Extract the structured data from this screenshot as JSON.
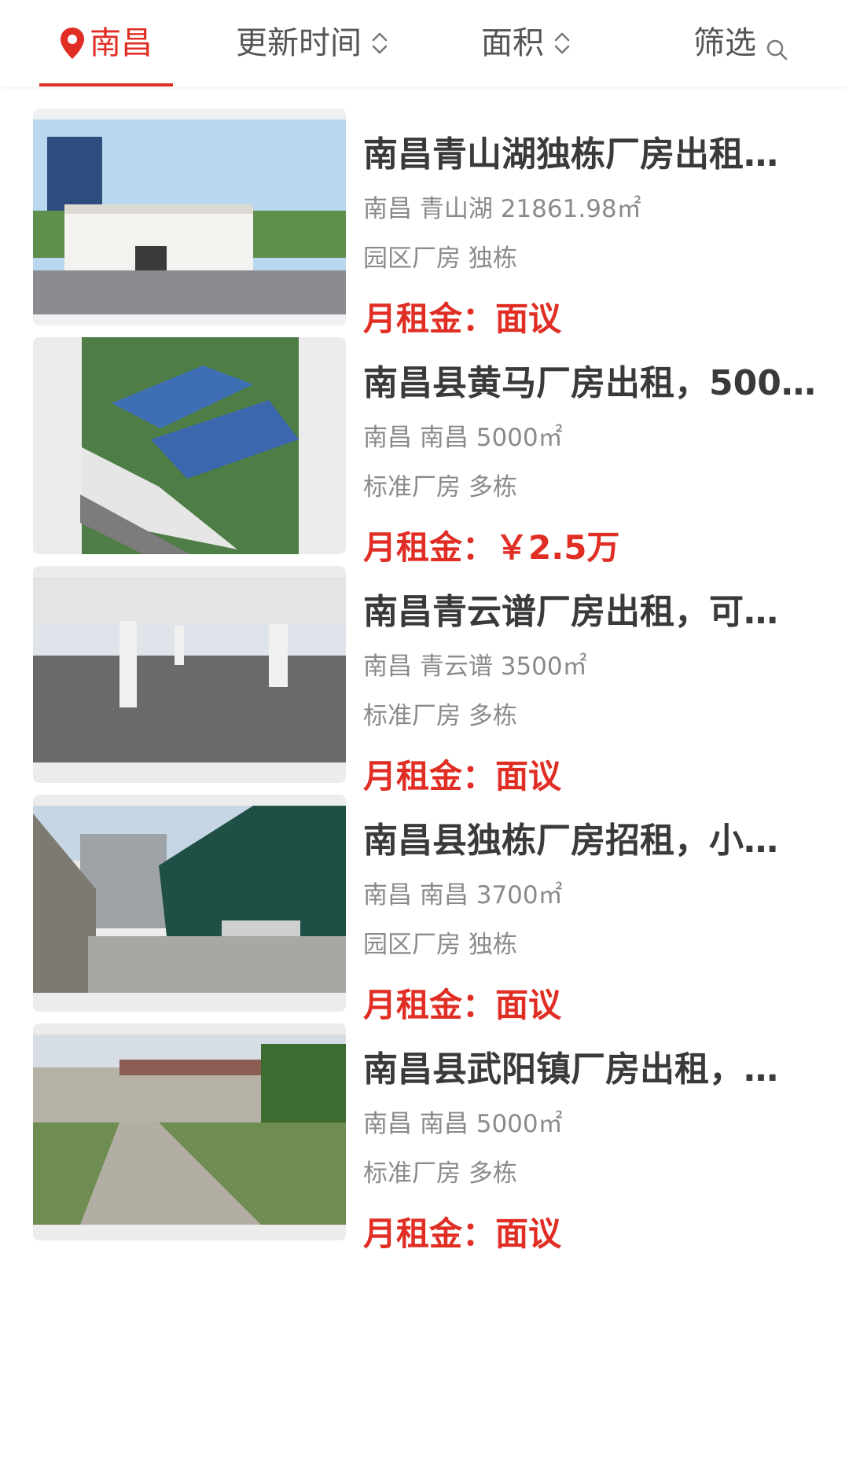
{
  "filter_bar": {
    "city": {
      "label": "南昌",
      "icon": "location-pin-icon"
    },
    "sort_time": {
      "label": "更新时间",
      "icon": "sort-updown-icon"
    },
    "sort_area": {
      "label": "面积",
      "icon": "sort-updown-icon"
    },
    "filter": {
      "label": "筛选",
      "icon": "search-icon"
    },
    "accent_color": "#e02e24"
  },
  "listings": [
    {
      "title": "南昌青山湖独栋厂房出租…",
      "city": "南昌",
      "district": "青山湖",
      "area": "21861.98㎡",
      "type": "园区厂房",
      "building": "独栋",
      "price_label": "月租金：",
      "price_value": "面议"
    },
    {
      "title": "南昌县黄马厂房出租，500…",
      "city": "南昌",
      "district": "南昌",
      "area": "5000㎡",
      "type": "标准厂房",
      "building": "多栋",
      "price_label": "月租金：",
      "price_value": "￥2.5万"
    },
    {
      "title": "南昌青云谱厂房出租，可…",
      "city": "南昌",
      "district": "青云谱",
      "area": "3500㎡",
      "type": "标准厂房",
      "building": "多栋",
      "price_label": "月租金：",
      "price_value": "面议"
    },
    {
      "title": "南昌县独栋厂房招租，小…",
      "city": "南昌",
      "district": "南昌",
      "area": "3700㎡",
      "type": "园区厂房",
      "building": "独栋",
      "price_label": "月租金：",
      "price_value": "面议"
    },
    {
      "title": "南昌县武阳镇厂房出租，…",
      "city": "南昌",
      "district": "南昌",
      "area": "5000㎡",
      "type": "标准厂房",
      "building": "多栋",
      "price_label": "月租金：",
      "price_value": "面议"
    }
  ]
}
